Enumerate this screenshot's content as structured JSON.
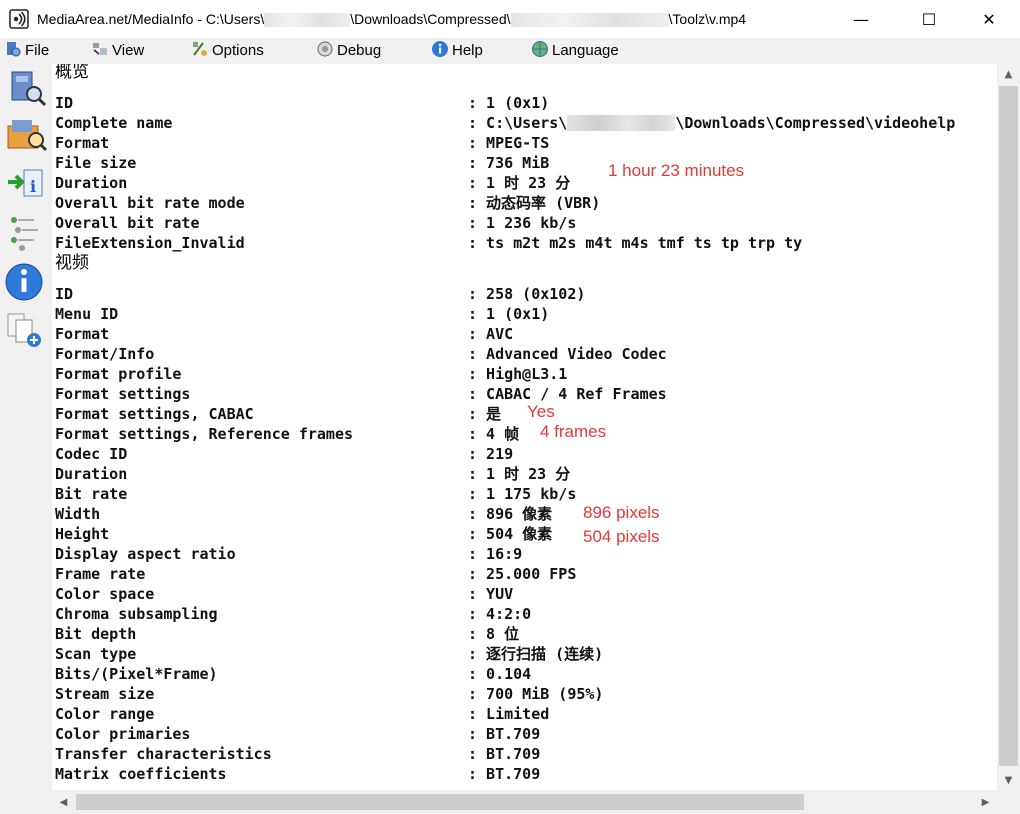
{
  "window": {
    "title_prefix": "MediaArea.net/MediaInfo - C:\\Users\\",
    "title_mid": "\\Downloads\\Compressed\\",
    "title_suffix": "\\Toolz\\v.mp4",
    "minimize_glyph": "—",
    "maximize_glyph": "☐",
    "close_glyph": "✕"
  },
  "menu": {
    "items": [
      {
        "label": "File",
        "icon": "file-icon"
      },
      {
        "label": "View",
        "icon": "view-icon"
      },
      {
        "label": "Options",
        "icon": "options-icon"
      },
      {
        "label": "Debug",
        "icon": "debug-icon"
      },
      {
        "label": "Help",
        "icon": "help-icon"
      },
      {
        "label": "Language",
        "icon": "language-icon"
      }
    ]
  },
  "toolbar": {
    "buttons": [
      "open-file-icon",
      "open-folder-icon",
      "export-icon",
      "sheet-view-icon",
      "info-icon",
      "copy-icon"
    ]
  },
  "general": {
    "heading": "概览",
    "rows": [
      {
        "label": "ID",
        "value": ": 1 (0x1)"
      },
      {
        "label": "Complete name",
        "value_prefix": ": C:\\Users\\",
        "value_suffix": "\\Downloads\\Compressed\\videohelp"
      },
      {
        "label": "Format",
        "value": ": MPEG-TS"
      },
      {
        "label": "File size",
        "value": ": 736 MiB"
      },
      {
        "label": "Duration",
        "value": ": 1 时 23 分"
      },
      {
        "label": "Overall bit rate mode",
        "value": ": 动态码率 (VBR)"
      },
      {
        "label": "Overall bit rate",
        "value": ": 1 236 kb/s"
      },
      {
        "label": "FileExtension_Invalid",
        "value": ": ts m2t m2s m4t m4s tmf ts tp trp ty"
      }
    ]
  },
  "video": {
    "heading": "视频",
    "rows": [
      {
        "label": "ID",
        "value": ": 258 (0x102)"
      },
      {
        "label": "Menu ID",
        "value": ": 1 (0x1)"
      },
      {
        "label": "Format",
        "value": ": AVC"
      },
      {
        "label": "Format/Info",
        "value": ": Advanced Video Codec"
      },
      {
        "label": "Format profile",
        "value": ": High@L3.1"
      },
      {
        "label": "Format settings",
        "value": ": CABAC / 4 Ref Frames"
      },
      {
        "label": "Format settings, CABAC",
        "value": ": 是"
      },
      {
        "label": "Format settings, Reference frames",
        "value": ": 4 帧"
      },
      {
        "label": "Codec ID",
        "value": ": 219"
      },
      {
        "label": "Duration",
        "value": ": 1 时 23 分"
      },
      {
        "label": "Bit rate",
        "value": ": 1 175 kb/s"
      },
      {
        "label": "Width",
        "value": ": 896 像素"
      },
      {
        "label": "Height",
        "value": ": 504 像素"
      },
      {
        "label": "Display aspect ratio",
        "value": ": 16:9"
      },
      {
        "label": "Frame rate",
        "value": ": 25.000 FPS"
      },
      {
        "label": "Color space",
        "value": ": YUV"
      },
      {
        "label": "Chroma subsampling",
        "value": ": 4:2:0"
      },
      {
        "label": "Bit depth",
        "value": ": 8 位"
      },
      {
        "label": "Scan type",
        "value": ": 逐行扫描 (连续)"
      },
      {
        "label": "Bits/(Pixel*Frame)",
        "value": ": 0.104"
      },
      {
        "label": "Stream size",
        "value": ": 700 MiB (95%)"
      },
      {
        "label": "Color range",
        "value": ": Limited"
      },
      {
        "label": "Color primaries",
        "value": ": BT.709"
      },
      {
        "label": "Transfer characteristics",
        "value": ": BT.709"
      },
      {
        "label": "Matrix coefficients",
        "value": ": BT.709"
      }
    ]
  },
  "annotations": {
    "duration": "1 hour 23 minutes",
    "cabac": "Yes",
    "ref_frames": "4 frames",
    "width": "896 pixels",
    "height": "504 pixels",
    "color": "#e53935"
  },
  "scroll": {
    "up": "▲",
    "down": "▼",
    "left": "◀",
    "right": "▶"
  }
}
